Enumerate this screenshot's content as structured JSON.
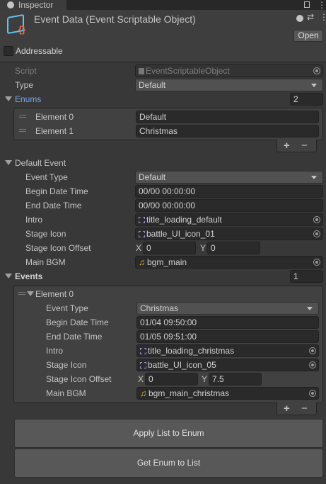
{
  "window": {
    "tab": "Inspector"
  },
  "header": {
    "title": "Event Data (Event Scriptable Object)",
    "open": "Open",
    "addressable": "Addressable",
    "addressable_checked": false
  },
  "fields": {
    "script_label": "Script",
    "script_value": "EventScriptableObject",
    "type_label": "Type",
    "type_value": "Default"
  },
  "enums": {
    "label": "Enums",
    "count": "2",
    "items": [
      {
        "label": "Element 0",
        "value": "Default"
      },
      {
        "label": "Element 1",
        "value": "Christmas"
      }
    ]
  },
  "default_event": {
    "label": "Default Event",
    "event_type_label": "Event Type",
    "event_type": "Default",
    "begin_label": "Begin Date Time",
    "begin": "00/00 00:00:00",
    "end_label": "End Date Time",
    "end": "00/00 00:00:00",
    "intro_label": "Intro",
    "intro": "title_loading_default",
    "stage_icon_label": "Stage Icon",
    "stage_icon": "battle_UI_icon_01",
    "offset_label": "Stage Icon Offset",
    "x_label": "X",
    "x": "0",
    "y_label": "Y",
    "y": "0",
    "bgm_label": "Main BGM",
    "bgm": "bgm_main"
  },
  "events": {
    "label": "Events",
    "count": "1",
    "element": {
      "label": "Element 0",
      "event_type_label": "Event Type",
      "event_type": "Christmas",
      "begin_label": "Begin Date Time",
      "begin": "01/04 09:50:00",
      "end_label": "End Date Time",
      "end": "01/05 09:51:00",
      "intro_label": "Intro",
      "intro": "title_loading_christmas",
      "stage_icon_label": "Stage Icon",
      "stage_icon": "battle_UI_icon_05",
      "offset_label": "Stage Icon Offset",
      "x_label": "X",
      "x": "0",
      "y_label": "Y",
      "y": "7.5",
      "bgm_label": "Main BGM",
      "bgm": "bgm_main_christmas"
    }
  },
  "list_controls": {
    "add": "+",
    "remove": "−"
  },
  "buttons": {
    "apply": "Apply List to Enum",
    "get": "Get Enum to List"
  },
  "colors": {
    "accent": "#7ba4e8",
    "background": "#383838"
  }
}
